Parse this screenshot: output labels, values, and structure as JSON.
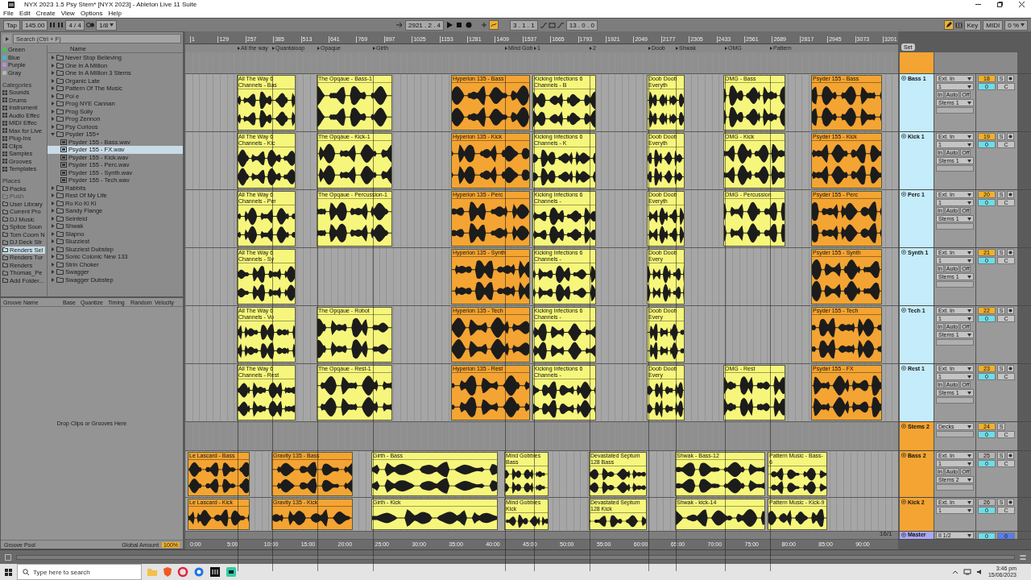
{
  "window": {
    "title": "NYX 2023 1.5 Psy Stem*  [NYX 2023] - Ableton Live 11 Suite"
  },
  "menu": [
    "File",
    "Edit",
    "Create",
    "View",
    "Options",
    "Help"
  ],
  "control_bar": {
    "tap": "Tap",
    "tempo": "145.00",
    "signature": "4 / 4",
    "quantize": "1/8",
    "position": "2921 .  2 .  4",
    "automation_arm": true,
    "loop_start": "3 .  1 .  1",
    "loop_length": "13 .  0 .  0",
    "draw_mode": true,
    "key": "Key",
    "midi": "MIDI",
    "cpu": "0 %"
  },
  "browser": {
    "search": {
      "placeholder": "Search (Ctrl + F)"
    },
    "colors": [
      {
        "label": "Green",
        "color": "#3ec65a"
      },
      {
        "label": "Blue",
        "color": "#3bb8d8"
      },
      {
        "label": "Purple",
        "color": "#b98de0"
      },
      {
        "label": "Gray",
        "color": "#b4b4b4"
      }
    ],
    "categories_title": "Categories",
    "categories": [
      "Sounds",
      "Drums",
      "Instrument",
      "Audio Effec",
      "MIDI Effec",
      "Max for Live",
      "Plug-Ins",
      "Clips",
      "Samples",
      "Grooves",
      "Templates"
    ],
    "places_title": "Places",
    "places": [
      {
        "label": "Packs",
        "selected": false,
        "disabled": false
      },
      {
        "label": "Push",
        "selected": false,
        "disabled": true
      },
      {
        "label": "User Library",
        "selected": false,
        "disabled": false
      },
      {
        "label": "Current Pro",
        "selected": false,
        "disabled": false
      },
      {
        "label": "DJ Music",
        "selected": false,
        "disabled": false
      },
      {
        "label": "Splice Soun",
        "selected": false,
        "disabled": false
      },
      {
        "label": "Tom Coom N",
        "selected": false,
        "disabled": false
      },
      {
        "label": "DJ Deck Str",
        "selected": false,
        "disabled": false
      },
      {
        "label": "Renders Sel",
        "selected": true,
        "disabled": false
      },
      {
        "label": "Renders Tur",
        "selected": false,
        "disabled": false
      },
      {
        "label": "Renders",
        "selected": false,
        "disabled": false
      },
      {
        "label": "Thomas_Pe",
        "selected": false,
        "disabled": false
      },
      {
        "label": "Add Folder...",
        "selected": false,
        "disabled": false
      }
    ],
    "name_header": "Name",
    "tree": [
      {
        "label": "Never Stop Believing",
        "kind": "folder",
        "expanded": false,
        "selected": false
      },
      {
        "label": "One In A Million",
        "kind": "folder",
        "expanded": false,
        "selected": false
      },
      {
        "label": "One In A Million 3 Stems",
        "kind": "folder",
        "expanded": false,
        "selected": false
      },
      {
        "label": "Organic Late",
        "kind": "folder",
        "expanded": false,
        "selected": false
      },
      {
        "label": "Pattern Of The Music",
        "kind": "folder",
        "expanded": false,
        "selected": false
      },
      {
        "label": "Poi e",
        "kind": "folder",
        "expanded": false,
        "selected": false
      },
      {
        "label": "Prog NYE Cannan",
        "kind": "folder",
        "expanded": false,
        "selected": false
      },
      {
        "label": "Prog Solly",
        "kind": "folder",
        "expanded": false,
        "selected": false
      },
      {
        "label": "Prog Zennon",
        "kind": "folder",
        "expanded": false,
        "selected": false
      },
      {
        "label": "Psy Curious",
        "kind": "folder",
        "expanded": false,
        "selected": false
      },
      {
        "label": "Psyder 155+",
        "kind": "folder",
        "expanded": true,
        "selected": false,
        "children": [
          {
            "label": "Psyder 155 - Bass.wav",
            "kind": "file",
            "selected": false
          },
          {
            "label": "Psyder 155 - FX.wav",
            "kind": "file",
            "selected": true
          },
          {
            "label": "Psyder 155 - Kick.wav",
            "kind": "file",
            "selected": false
          },
          {
            "label": "Psyder 155 - Perc.wav",
            "kind": "file",
            "selected": false
          },
          {
            "label": "Psyder 155 - Synth.wav",
            "kind": "file",
            "selected": false
          },
          {
            "label": "Psyder 155 - Tech.wav",
            "kind": "file",
            "selected": false
          }
        ]
      },
      {
        "label": "Rabbits",
        "kind": "folder",
        "expanded": false,
        "selected": false
      },
      {
        "label": "Rest Of My Life",
        "kind": "folder",
        "expanded": false,
        "selected": false
      },
      {
        "label": "Ro Ko Ki Ki",
        "kind": "folder",
        "expanded": false,
        "selected": false
      },
      {
        "label": "Sandy Flange",
        "kind": "folder",
        "expanded": false,
        "selected": false
      },
      {
        "label": "Seinfeld",
        "kind": "folder",
        "expanded": false,
        "selected": false
      },
      {
        "label": "Shwak",
        "kind": "folder",
        "expanded": false,
        "selected": false
      },
      {
        "label": "Slapno",
        "kind": "folder",
        "expanded": false,
        "selected": false
      },
      {
        "label": "Sluzziest",
        "kind": "folder",
        "expanded": false,
        "selected": false
      },
      {
        "label": "Sluzziest Dubstep",
        "kind": "folder",
        "expanded": false,
        "selected": false
      },
      {
        "label": "Sonic Colonic New 133",
        "kind": "folder",
        "expanded": false,
        "selected": false
      },
      {
        "label": "Strin Choker",
        "kind": "folder",
        "expanded": false,
        "selected": false
      },
      {
        "label": "Swagger",
        "kind": "folder",
        "expanded": false,
        "selected": false
      },
      {
        "label": "Swagger Dubstep",
        "kind": "folder",
        "expanded": false,
        "selected": false
      }
    ]
  },
  "groove_pool": {
    "columns": [
      "Groove Name",
      "Base",
      "Quantize",
      "Timing",
      "Random",
      "Velocity"
    ],
    "hint": "Drop Clips or Grooves Here",
    "footer_label": "Groove Pool",
    "amount_label": "Global Amount",
    "amount": "100%"
  },
  "arrangement": {
    "ruler": [
      "1",
      "129",
      "257",
      "385",
      "513",
      "641",
      "769",
      "897",
      "1025",
      "1153",
      "1281",
      "1409",
      "1537",
      "1665",
      "1793",
      "1921",
      "2049",
      "2177",
      "2305",
      "2433",
      "2561",
      "2689",
      "2817",
      "2945",
      "3073",
      "3201"
    ],
    "locators": [
      "All the way",
      "Quantaloop",
      "Opaque",
      "Girth",
      "Mind Gob",
      "1",
      "2",
      "Doob",
      "Shwak",
      "OMG",
      "Pattern"
    ],
    "time_ruler": [
      "0:00",
      "5:00",
      "10:00",
      "15:00",
      "20:00",
      "25:00",
      "30:00",
      "35:00",
      "40:00",
      "45:00",
      "50:00",
      "55:00",
      "60:00",
      "65:00",
      "70:00",
      "75:00",
      "80:00",
      "85:00",
      "90:00"
    ],
    "zoom_readout": "16/1",
    "set_button": "Set"
  },
  "tracks": [
    {
      "kind": "group",
      "color": "#f4a432"
    },
    {
      "kind": "audio",
      "name": "Bass 1",
      "color": "#c5ecfb",
      "input": "Ext. In",
      "channel": "1",
      "monitor": [
        "In",
        "Auto",
        "Off"
      ],
      "output": "Stems 1",
      "number": "18",
      "active": true,
      "solo": "S",
      "volume": "0",
      "pan": "C",
      "clips": [
        {
          "name": "All The Way 6 Channels - Bas",
          "color": "#f6f67c"
        },
        {
          "name": "The Opqaue - Bass-1",
          "color": "#f6f67c"
        },
        {
          "name": "Hyperion 135 - Bass",
          "color": "#f4a432"
        },
        {
          "name": "Kicking Infections 6 Channels - B",
          "color": "#f6f67c"
        },
        {
          "name": "Doob Doob Everyth",
          "color": "#f6f67c"
        },
        {
          "name": "OMG - Bass",
          "color": "#f6f67c"
        },
        {
          "name": "Psyder 155 - Bass",
          "color": "#f4a432"
        }
      ]
    },
    {
      "kind": "audio",
      "name": "Kick 1",
      "color": "#c5ecfb",
      "input": "Ext. In",
      "channel": "1",
      "monitor": [
        "In",
        "Auto",
        "Off"
      ],
      "output": "Stems 1",
      "number": "19",
      "active": true,
      "solo": "S",
      "volume": "0",
      "pan": "C",
      "clips": [
        {
          "name": "All The Way 6 Channels - Kic",
          "color": "#f6f67c"
        },
        {
          "name": "The Opqaue - Kick-1",
          "color": "#f6f67c"
        },
        {
          "name": "Hyperion 135 - Kick",
          "color": "#f4a432"
        },
        {
          "name": "Kicking Infections 6 Channels - K",
          "color": "#f6f67c"
        },
        {
          "name": "Doob Doob Everyth",
          "color": "#f6f67c"
        },
        {
          "name": "OMG - Kick",
          "color": "#f6f67c"
        },
        {
          "name": "Psyder 155 - Kick",
          "color": "#f4a432"
        }
      ]
    },
    {
      "kind": "audio",
      "name": "Perc 1",
      "color": "#c5ecfb",
      "input": "Ext. In",
      "channel": "1",
      "monitor": [
        "In",
        "Auto",
        "Off"
      ],
      "output": "Stems 1",
      "number": "20",
      "active": true,
      "solo": "S",
      "volume": "0",
      "pan": "C",
      "clips": [
        {
          "name": "All The Way 6 Channels - Per",
          "color": "#f6f67c"
        },
        {
          "name": "The Opqaue - Percussion-1",
          "color": "#f6f67c"
        },
        {
          "name": "Hyperion 135 - Perc",
          "color": "#f4a432"
        },
        {
          "name": "Kicking Infections 6 Channels -",
          "color": "#f6f67c"
        },
        {
          "name": "Doob Doob Everyth",
          "color": "#f6f67c"
        },
        {
          "name": "OMG - Percussion",
          "color": "#f6f67c"
        },
        {
          "name": "Psyder 155 - Perc",
          "color": "#f4a432"
        }
      ]
    },
    {
      "kind": "audio",
      "name": "Synth 1",
      "color": "#c5ecfb",
      "input": "Ext. In",
      "channel": "1",
      "monitor": [
        "In",
        "Auto",
        "Off"
      ],
      "output": "Stems 1",
      "number": "21",
      "active": true,
      "solo": "S",
      "volume": "0",
      "pan": "C",
      "clips": [
        {
          "name": "All The Way 6 Channels - Sy",
          "color": "#f6f67c"
        },
        {
          "name": "Hyperion 135 - Synth",
          "color": "#f4a432"
        },
        {
          "name": "Kicking Infections 6 Channels -",
          "color": "#f6f67c"
        },
        {
          "name": "Doob Doob Every",
          "color": "#f6f67c"
        },
        {
          "name": "Psyder 155 - Synth",
          "color": "#f4a432"
        }
      ]
    },
    {
      "kind": "audio",
      "name": "Tech 1",
      "color": "#c5ecfb",
      "input": "Ext. In",
      "channel": "1",
      "monitor": [
        "In",
        "Auto",
        "Off"
      ],
      "output": "Stems 1",
      "number": "22",
      "active": true,
      "solo": "S",
      "volume": "0",
      "pan": "C",
      "clips": [
        {
          "name": "All The Way 6 Channels - Vo",
          "color": "#f6f67c"
        },
        {
          "name": "The Opqaue - Robot",
          "color": "#f6f67c"
        },
        {
          "name": "Hyperion 135 - Tech",
          "color": "#f4a432"
        },
        {
          "name": "Kicking Infections 6 Channels -",
          "color": "#f6f67c"
        },
        {
          "name": "Doob Doob Every",
          "color": "#f6f67c"
        },
        {
          "name": "Psyder 155 - Tech",
          "color": "#f4a432"
        }
      ]
    },
    {
      "kind": "audio",
      "name": "Rest 1",
      "color": "#c5ecfb",
      "input": "Ext. In",
      "channel": "1",
      "monitor": [
        "In",
        "Auto",
        "Off"
      ],
      "output": "Stems 1",
      "number": "23",
      "active": true,
      "solo": "S",
      "volume": "0",
      "pan": "C",
      "clips": [
        {
          "name": "All The Way 6 Channels - Rest",
          "color": "#f6f67c"
        },
        {
          "name": "The Opqaue - Rest-1",
          "color": "#f6f67c"
        },
        {
          "name": "Hyperion 135 - Rest",
          "color": "#f4a432"
        },
        {
          "name": "Kicking Infections 6 Channels -",
          "color": "#f6f67c"
        },
        {
          "name": "Doob Doob Every",
          "color": "#f6f67c"
        },
        {
          "name": "OMG - Rest",
          "color": "#f6f67c"
        },
        {
          "name": "Psyder 155 - FX",
          "color": "#f4a432"
        }
      ]
    },
    {
      "kind": "group",
      "name": "Stems 2",
      "color": "#f4a432",
      "output": "Decks",
      "number": "24",
      "active": true,
      "solo": "S",
      "volume": "0",
      "pan": "C"
    },
    {
      "kind": "audio",
      "name": "Bass 2",
      "color": "#f4a432",
      "input": "Ext. In",
      "channel": "1",
      "monitor": [
        "In",
        "Auto",
        "Off"
      ],
      "output": "Stems 2",
      "number": "25",
      "active": false,
      "solo": "S",
      "volume": "0",
      "pan": "C",
      "clips": [
        {
          "name": "Le Lascard - Bass",
          "color": "#f4a432"
        },
        {
          "name": "Gravity 135 - Bass",
          "color": "#f4a432"
        },
        {
          "name": "Girth - Bass",
          "color": "#f6f67c"
        },
        {
          "name": "Mind Gobbies Bass",
          "color": "#f6f67c"
        },
        {
          "name": "Devastated Septum 128 Bass",
          "color": "#f6f67c"
        },
        {
          "name": "Shwak - Bass-12",
          "color": "#f6f67c"
        },
        {
          "name": "Pattern Music - Bass-6",
          "color": "#f6f67c"
        }
      ]
    },
    {
      "kind": "audio",
      "name": "Kick 2",
      "color": "#f4a432",
      "input": "Ext. In",
      "channel": "1",
      "number": "26",
      "active": false,
      "solo": "S",
      "volume": "0",
      "pan": "C",
      "clips": [
        {
          "name": "Le Lascard - Kick",
          "color": "#f4a432"
        },
        {
          "name": "Gravity 135 - Kick",
          "color": "#f4a432"
        },
        {
          "name": "Girth - Kick",
          "color": "#f6f67c"
        },
        {
          "name": "Mind Gobbies Kick",
          "color": "#f6f67c"
        },
        {
          "name": "Devastated Septum 128 Kick",
          "color": "#f6f67c"
        },
        {
          "name": "Shwak - kick-14",
          "color": "#f6f67c"
        },
        {
          "name": "Pattern Music - Kick-9",
          "color": "#f6f67c"
        }
      ]
    },
    {
      "kind": "master",
      "name": "Master",
      "color": "#a9a9f5",
      "output": "II 1/2",
      "volume": "0",
      "pan": "0"
    }
  ],
  "taskbar": {
    "search_placeholder": "Type here to search",
    "time": "3:46 pm",
    "date": "15/06/2023"
  }
}
